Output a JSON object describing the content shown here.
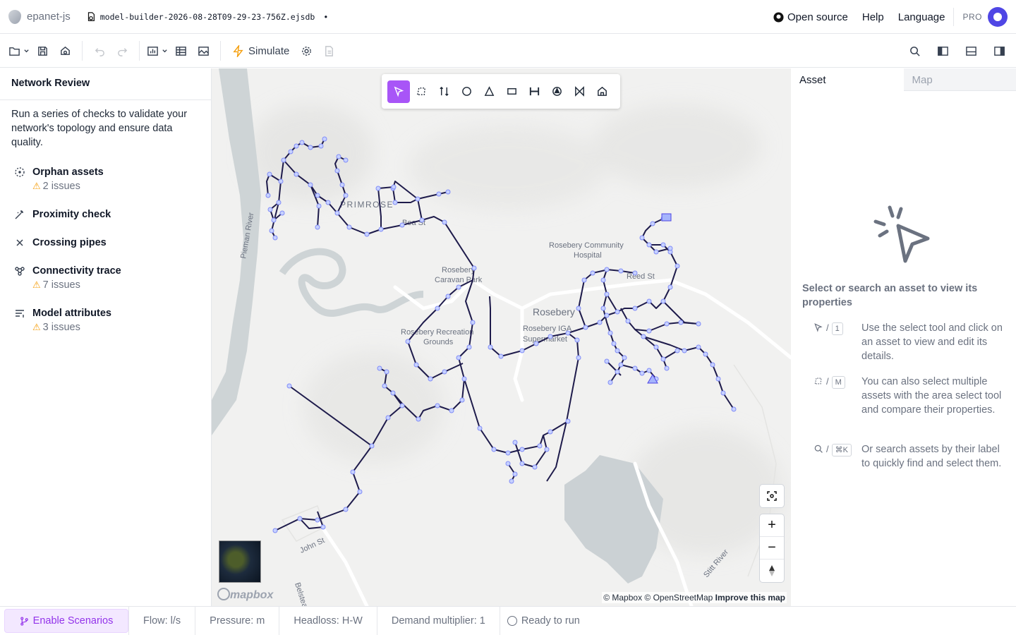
{
  "app": {
    "name": "epanet-js",
    "filename": "model-builder-2026-08-28T09-29-23-756Z.ejsdb",
    "unsaved_marker": "•"
  },
  "topnav": {
    "open_source": "Open source",
    "help": "Help",
    "language": "Language",
    "pro": "PRO"
  },
  "toolbar": {
    "simulate": "Simulate"
  },
  "left_panel": {
    "title": "Network Review",
    "intro": "Run a series of checks to validate your network's topology and ensure data quality.",
    "checks": [
      {
        "title": "Orphan assets",
        "issues": "2 issues",
        "icon": "dashed-circle-icon"
      },
      {
        "title": "Proximity check",
        "issues": "",
        "icon": "sparkle-icon"
      },
      {
        "title": "Crossing pipes",
        "issues": "",
        "icon": "cross-icon"
      },
      {
        "title": "Connectivity trace",
        "issues": "7 issues",
        "icon": "nodes-icon"
      },
      {
        "title": "Model attributes",
        "issues": "3 issues",
        "icon": "list-icon"
      }
    ]
  },
  "map": {
    "labels": {
      "primrose": "PRIMROSE",
      "hospital_1": "Rosebery Community",
      "hospital_2": "Hospital",
      "caravan_1": "Rosebery",
      "caravan_2": "Caravan Park",
      "rosebery": "Rosebery",
      "rec_1": "Rosebery Recreation",
      "rec_2": "Grounds",
      "super_1": "Rosebery IGA",
      "super_2": "Supermarket",
      "pieman": "Pieman River",
      "john": "John St",
      "stitt": "Stitt River",
      "reed": "Reed St",
      "belstead": "Belstead",
      "bea": "Bea St"
    },
    "mapbox_logo": "mapbox",
    "attribution": "© Mapbox © OpenStreetMap",
    "improve": "Improve this map",
    "zoom_in": "+",
    "zoom_out": "−"
  },
  "right_panel": {
    "tabs": [
      "Asset",
      "Map"
    ],
    "empty_title": "Select or search an asset to view its properties",
    "hints": [
      {
        "key": "1",
        "text": "Use the select tool and click on an asset to view and edit its details."
      },
      {
        "key": "M",
        "text": "You can also select multiple assets with the area select tool and compare their properties."
      },
      {
        "key": "⌘K",
        "text": "Or search assets by their label to quickly find and select them."
      }
    ]
  },
  "statusbar": {
    "scenarios": "Enable Scenarios",
    "flow": "Flow: l/s",
    "pressure": "Pressure: m",
    "headloss": "Headloss: H-W",
    "demand": "Demand multiplier: 1",
    "run": "Ready to run"
  },
  "colors": {
    "accent": "#a855f7",
    "pipe": "#1e1b4b",
    "node": "#a5b4fc"
  }
}
